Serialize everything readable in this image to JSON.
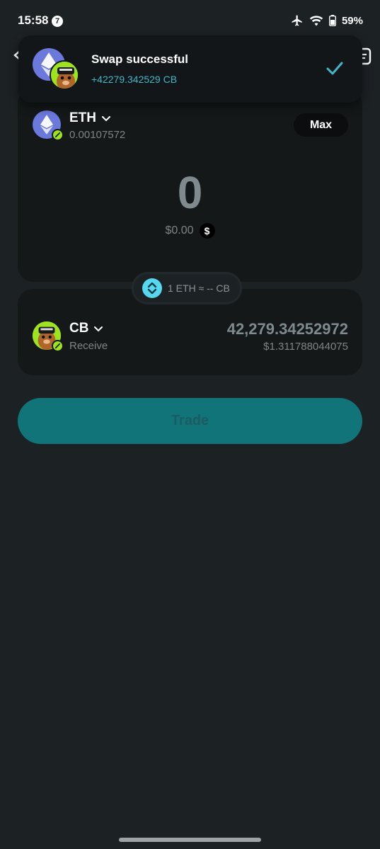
{
  "status_bar": {
    "time": "15:58",
    "notification_count": "7",
    "battery_percent": "59%"
  },
  "toast": {
    "title": "Swap successful",
    "subtitle": "+42279.342529 CB",
    "icons": [
      "eth-token-icon",
      "cb-token-icon",
      "checkmark-icon"
    ]
  },
  "from_token": {
    "symbol": "ETH",
    "balance": "0.00107572",
    "max_label": "Max",
    "amount": "0",
    "amount_usd": "$0.00",
    "currency_toggle": "$"
  },
  "rate": {
    "text": "1 ETH ≈ -- CB"
  },
  "to_token": {
    "symbol": "CB",
    "sub_label": "Receive",
    "amount": "42,279.34252972",
    "amount_usd": "$1.311788044075"
  },
  "trade_button": {
    "label": "Trade"
  },
  "colors": {
    "background": "#1c2124",
    "card": "#141819",
    "accent_teal": "#107479",
    "toast_text_accent": "#3fb7c9",
    "eth_blue": "#6b79dc",
    "cb_green": "#9ee31f"
  }
}
